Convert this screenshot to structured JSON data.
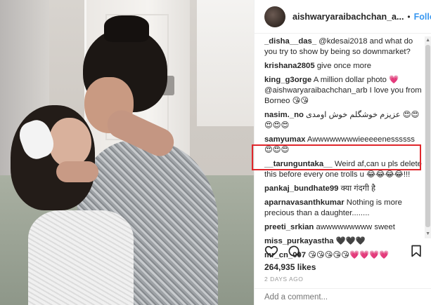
{
  "post": {
    "username": "aishwaryaraibachchan_a...",
    "separator": "•",
    "follow_label": "Follow"
  },
  "comments": [
    {
      "user": "_disha__das_",
      "text": "@kdesai2018 and what do you try to show by being so downmarket?"
    },
    {
      "user": "krishana2805",
      "text": "give once more"
    },
    {
      "user": "king_g3orge",
      "text": "A million dollar photo 💗 @aishwaryaraibachchan_arb I love you from Borneo 😘😘"
    },
    {
      "user": "nasim._no",
      "text": "عزیزم خوشگلم خوش اومدی 😍😍😍😍😍"
    },
    {
      "user": "samyumax",
      "text": "Awwwwwwwwieeeeenessssss 😍😍😍"
    },
    {
      "user": "__tarunguntaka__",
      "text": "Weird af,can u pls delete this before every one trolls u 😂😂😂😂!!!"
    },
    {
      "user": "pankaj_bundhate99",
      "text": "क्या गंदगी है"
    },
    {
      "user": "aparnavasanthkumar",
      "text": "Nothing is more precious than a daughter........"
    },
    {
      "user": "preeti_srkian",
      "text": "awwwwwwwww sweet"
    },
    {
      "user": "miss_purkayastha",
      "text": "🖤🖤🖤"
    },
    {
      "user": "mr_cn_007",
      "text": "😘😘😘😘😘💗💗💗💗"
    }
  ],
  "likes": "264,935 likes",
  "time": "2 DAYS AGO",
  "add_comment_placeholder": "Add a comment...",
  "icons": [
    "heart-icon",
    "comment-icon",
    "bookmark-icon"
  ],
  "colors": {
    "follow": "#3897f0",
    "highlight": "#e0262b"
  }
}
